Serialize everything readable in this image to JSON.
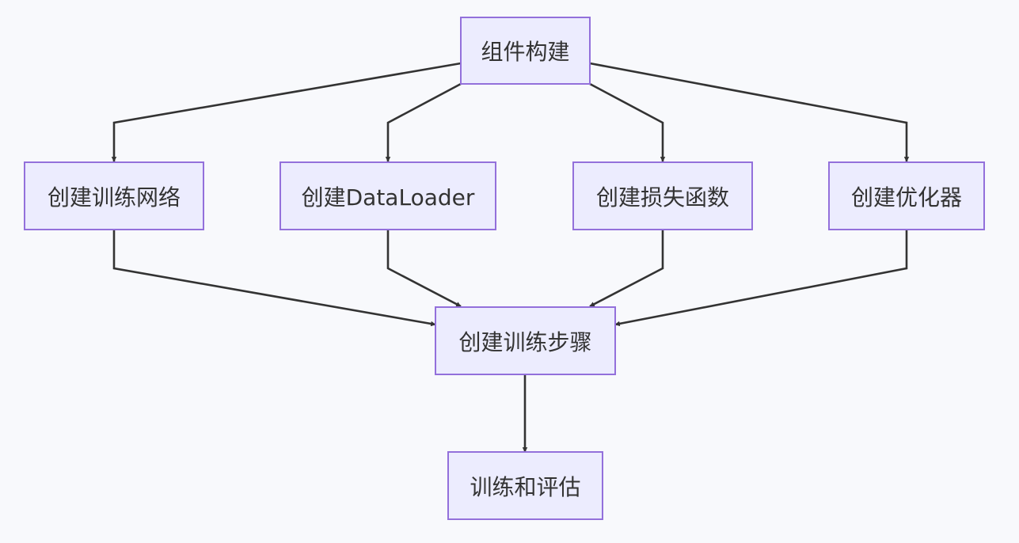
{
  "diagram": {
    "nodes": {
      "build_components": "组件构建",
      "create_network": "创建训练网络",
      "create_dataloader": "创建DataLoader",
      "create_loss": "创建损失函数",
      "create_optimizer": "创建优化器",
      "create_train_step": "创建训练步骤",
      "train_and_eval": "训练和评估"
    },
    "edges": [
      {
        "from": "build_components",
        "to": "create_network"
      },
      {
        "from": "build_components",
        "to": "create_dataloader"
      },
      {
        "from": "build_components",
        "to": "create_loss"
      },
      {
        "from": "build_components",
        "to": "create_optimizer"
      },
      {
        "from": "create_network",
        "to": "create_train_step"
      },
      {
        "from": "create_dataloader",
        "to": "create_train_step"
      },
      {
        "from": "create_loss",
        "to": "create_train_step"
      },
      {
        "from": "create_optimizer",
        "to": "create_train_step"
      },
      {
        "from": "create_train_step",
        "to": "train_and_eval"
      }
    ],
    "colors": {
      "background": "#f8f9fc",
      "node_fill": "#ececfe",
      "node_border": "#9370db",
      "line": "#333333",
      "text": "#333333"
    }
  }
}
